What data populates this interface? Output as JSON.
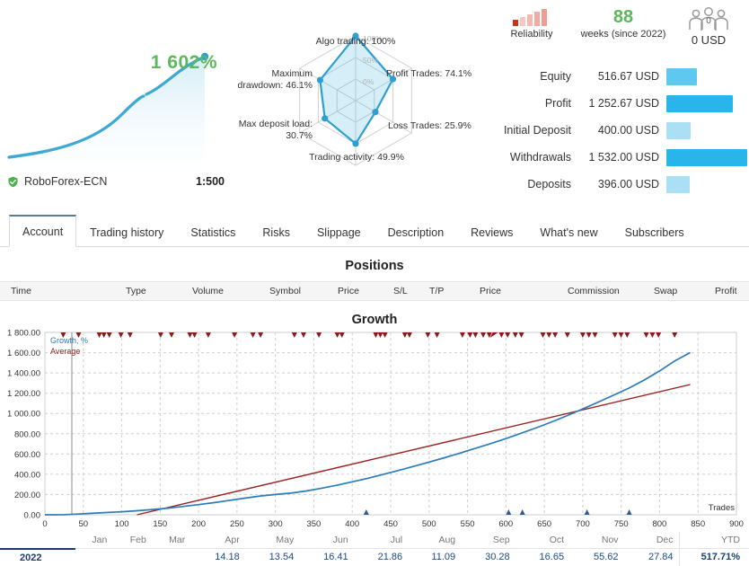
{
  "summary": {
    "growth_percent": "1 602%",
    "broker": "RoboForex-ECN",
    "broker_icon": "verified-shield-icon",
    "leverage": "1:500",
    "sparkline": [
      0,
      3,
      7,
      12,
      18,
      26,
      36,
      48,
      62,
      78,
      96,
      100
    ]
  },
  "radar": {
    "labels": {
      "algo": "Algo trading: 100%",
      "profit_trades": "Profit Trades:\n74.1%",
      "loss_trades": "Loss Trades:\n25.9%",
      "trading_activity": "Trading activity: 49.9%",
      "max_deposit_load": "Max deposit load:\n30.7%",
      "max_drawdown": "Maximum\ndrawdown: 46.1%"
    },
    "ring_labels": [
      "100%",
      "50%",
      "0%"
    ],
    "axes": [
      "Algo trading",
      "Profit Trades",
      "Loss Trades",
      "Trading activity",
      "Max deposit load",
      "Maximum drawdown"
    ],
    "values": [
      100,
      74.1,
      25.9,
      49.9,
      30.7,
      46.1
    ]
  },
  "badges": {
    "reliability_label": "Reliability",
    "reliability_icon": "bar-meter-icon",
    "weeks_number": "88",
    "weeks_label": "weeks (since 2022)",
    "subscribers_icon": "people-group-icon",
    "subscribers_count": "0",
    "subscribers_value": "0 USD"
  },
  "stats": [
    {
      "label": "Equity",
      "value": "516.67 USD",
      "bar_pct": 37,
      "color": "#5ec8ee"
    },
    {
      "label": "Profit",
      "value": "1 252.67 USD",
      "bar_pct": 80,
      "color": "#29b5ea"
    },
    {
      "label": "Initial Deposit",
      "value": "400.00 USD",
      "bar_pct": 29,
      "color": "#aadff4"
    },
    {
      "label": "Withdrawals",
      "value": "1 532.00 USD",
      "bar_pct": 98,
      "color": "#29b5ea"
    },
    {
      "label": "Deposits",
      "value": "396.00 USD",
      "bar_pct": 28,
      "color": "#aadff4"
    }
  ],
  "tabs": [
    {
      "label": "Account",
      "active": true
    },
    {
      "label": "Trading history",
      "active": false
    },
    {
      "label": "Statistics",
      "active": false
    },
    {
      "label": "Risks",
      "active": false
    },
    {
      "label": "Slippage",
      "active": false
    },
    {
      "label": "Description",
      "active": false
    },
    {
      "label": "Reviews",
      "active": false
    },
    {
      "label": "What's new",
      "active": false
    },
    {
      "label": "Subscribers",
      "active": false
    }
  ],
  "positions": {
    "title": "Positions",
    "columns": [
      "Time",
      "Type",
      "Volume",
      "Symbol",
      "Price",
      "S/L",
      "T/P",
      "Price",
      "Commission",
      "Swap",
      "Profit"
    ],
    "rows": []
  },
  "chart_data": {
    "type": "line",
    "title": "Growth",
    "xlabel": "Trades",
    "ylabel": "",
    "xlim": [
      0,
      900
    ],
    "ylim": [
      0,
      1800
    ],
    "xticks": [
      0,
      50,
      100,
      150,
      200,
      250,
      300,
      350,
      400,
      450,
      500,
      550,
      600,
      650,
      700,
      750,
      800,
      850,
      900
    ],
    "yticks": [
      "0.00",
      "200.00",
      "400.00",
      "600.00",
      "800.00",
      "1 000.00",
      "1 200.00",
      "1 400.00",
      "1 600.00",
      "1 800.00"
    ],
    "grid": true,
    "legend": [
      "Growth, %",
      "Average"
    ],
    "legend_position": "top-left",
    "series": [
      {
        "name": "Growth, %",
        "color": "#2b7cb8",
        "x": [
          0,
          25,
          40,
          60,
          80,
          100,
          120,
          140,
          160,
          180,
          200,
          220,
          240,
          260,
          280,
          300,
          320,
          340,
          360,
          380,
          400,
          420,
          440,
          460,
          480,
          500,
          520,
          540,
          560,
          580,
          600,
          620,
          640,
          660,
          680,
          700,
          720,
          740,
          760,
          780,
          800,
          820,
          840
        ],
        "y": [
          0,
          1,
          6,
          14,
          22,
          30,
          40,
          52,
          66,
          82,
          100,
          120,
          142,
          164,
          185,
          200,
          214,
          235,
          262,
          292,
          325,
          360,
          398,
          437,
          478,
          520,
          563,
          608,
          655,
          702,
          752,
          805,
          860,
          918,
          980,
          1045,
          1112,
          1180,
          1250,
          1330,
          1420,
          1520,
          1602
        ]
      },
      {
        "name": "Average",
        "color": "#9b2020",
        "x": [
          120,
          840
        ],
        "y": [
          0,
          1285
        ]
      }
    ],
    "markers_top": {
      "name": "withdrawal-markers",
      "color": "#8b1a1a",
      "shape": "triangle-down",
      "x": [
        25,
        45,
        72,
        78,
        85,
        100,
        112,
        152,
        166,
        190,
        196,
        214,
        248,
        272,
        282,
        326,
        338,
        358,
        382,
        388,
        432,
        438,
        444,
        470,
        476,
        500,
        512,
        545,
        555,
        562,
        572,
        580,
        588,
        596,
        604,
        614,
        622,
        650,
        658,
        666,
        682
      ]
    },
    "markers_bottom": {
      "name": "deposit-markers",
      "color": "#2e5c8a",
      "shape": "triangle-up",
      "x": [
        415,
        600,
        618,
        702,
        758
      ]
    }
  },
  "months": {
    "columns": [
      "",
      "Jan",
      "Feb",
      "Mar",
      "Apr",
      "May",
      "Jun",
      "Jul",
      "Aug",
      "Sep",
      "Oct",
      "Nov",
      "Dec",
      "YTD"
    ],
    "rows": [
      {
        "year": "2022",
        "values": [
          "",
          "",
          "",
          "14.18",
          "13.54",
          "16.41",
          "21.86",
          "11.09",
          "30.28",
          "16.65",
          "55.62",
          "27.84"
        ],
        "ytd": "517.71%"
      }
    ]
  }
}
